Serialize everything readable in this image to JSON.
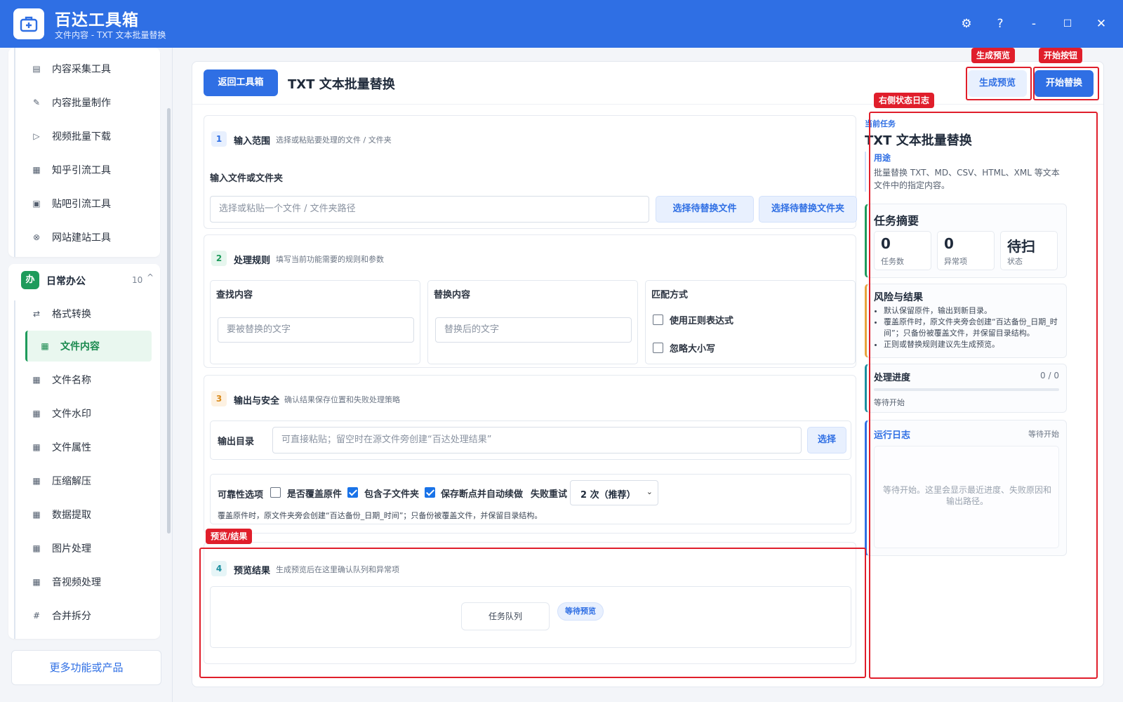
{
  "app": {
    "title": "百达工具箱",
    "subtitle": "文件内容 - TXT 文本批量替换",
    "controls": {
      "settings": "⚙",
      "help": "?",
      "minimize": "-",
      "maximize": "☐",
      "close": "✕"
    }
  },
  "sidebar": {
    "top_items": [
      {
        "label": "内容采集工具",
        "icon": "doc-icon"
      },
      {
        "label": "内容批量制作",
        "icon": "pen-icon"
      },
      {
        "label": "视频批量下载",
        "icon": "video-icon"
      },
      {
        "label": "知乎引流工具",
        "icon": "zhihu-icon"
      },
      {
        "label": "贴吧引流工具",
        "icon": "tieba-icon"
      },
      {
        "label": "网站建站工具",
        "icon": "globe-icon"
      }
    ],
    "group": {
      "badge": "办",
      "title": "日常办公",
      "count": "10",
      "caret": "^"
    },
    "group_items": [
      {
        "label": "格式转换",
        "icon": "swap-icon"
      },
      {
        "label": "文件内容",
        "icon": "grid-icon"
      },
      {
        "label": "文件名称",
        "icon": "grid-icon"
      },
      {
        "label": "文件水印",
        "icon": "grid-icon"
      },
      {
        "label": "文件属性",
        "icon": "grid-icon"
      },
      {
        "label": "压缩解压",
        "icon": "grid-icon"
      },
      {
        "label": "数据提取",
        "icon": "grid-icon"
      },
      {
        "label": "图片处理",
        "icon": "grid-icon"
      },
      {
        "label": "音视频处理",
        "icon": "grid-icon"
      },
      {
        "label": "合并拆分",
        "icon": "hash-icon"
      }
    ],
    "active_item": "文件内容",
    "more": "更多功能或产品"
  },
  "header": {
    "back": "返回工具箱",
    "title": "TXT 文本批量替换",
    "preview": "生成预览",
    "start": "开始替换"
  },
  "s1": {
    "num": "1",
    "title": "输入范围",
    "desc": "选择或粘贴要处理的文件 / 文件夹",
    "field_label": "输入文件或文件夹",
    "placeholder": "选择或粘贴一个文件 / 文件夹路径",
    "btn_file": "选择待替换文件",
    "btn_folder": "选择待替换文件夹"
  },
  "s2": {
    "num": "2",
    "title": "处理规则",
    "desc": "填写当前功能需要的规则和参数",
    "find_title": "查找内容",
    "find_placeholder": "要被替换的文字",
    "replace_title": "替换内容",
    "replace_placeholder": "替换后的文字",
    "match_title": "匹配方式",
    "regex": "使用正则表达式",
    "ignore_case": "忽略大小写"
  },
  "s3": {
    "num": "3",
    "title": "输出与安全",
    "desc": "确认结果保存位置和失败处理策略",
    "output_label": "输出目录",
    "output_placeholder": "可直接粘贴；留空时在源文件旁创建“百达处理结果”",
    "choose": "选择",
    "rel_label": "可靠性选项",
    "overwrite": "是否覆盖原件",
    "subfolder": "包含子文件夹",
    "resume": "保存断点并自动续做",
    "retry_label": "失败重试",
    "retry_value": "2 次（推荐）",
    "note": "覆盖原件时，原文件夹旁会创建“百达备份_日期_时间”；只备份被覆盖文件，并保留目录结构。"
  },
  "s4": {
    "num": "4",
    "title": "预览结果",
    "desc": "生成预览后在这里确认队列和异常项",
    "queue": "任务队列",
    "status": "等待预览"
  },
  "right": {
    "current_label": "当前任务",
    "task_title": "TXT 文本批量替换",
    "usage_head": "用途",
    "usage_text": "批量替换 TXT、MD、CSV、HTML、XML 等文本文件中的指定内容。",
    "summary_title": "任务摘要",
    "stats": [
      {
        "value": "0",
        "label": "任务数"
      },
      {
        "value": "0",
        "label": "异常项"
      },
      {
        "value": "待扫",
        "label": "状态"
      }
    ],
    "risk_title": "风险与结果",
    "risks": [
      "默认保留原件，输出到新目录。",
      "覆盖原件时，原文件夹旁会创建“百达备份_日期_时间”；只备份被覆盖文件，并保留目录结构。",
      "正则或替换规则建议先生成预览。"
    ],
    "progress_title": "处理进度",
    "progress_count": "0 / 0",
    "progress_value": 0,
    "progress_status": "等待开始",
    "log_title": "运行日志",
    "log_status": "等待开始",
    "log_empty": "等待开始。这里会显示最近进度、失败原因和输出路径。"
  },
  "annotations": {
    "preview_btn": "生成预览",
    "start_btn": "开始按钮",
    "right_log": "右侧状态日志",
    "preview_result": "预览/结果"
  },
  "colors": {
    "brand": "#2f6fe4",
    "active_green": "#1e9b5b",
    "annotation_red": "#e01e2b"
  }
}
